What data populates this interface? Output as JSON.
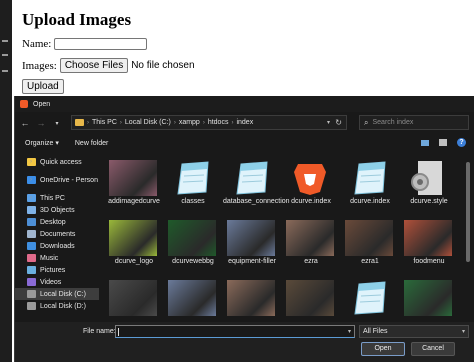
{
  "webpage": {
    "heading": "Upload Images",
    "name_label": "Name:",
    "name_value": "",
    "images_label": "Images:",
    "choose_files": "Choose Files",
    "no_file": "No file chosen",
    "upload": "Upload"
  },
  "dialog": {
    "title": "Open",
    "breadcrumbs": [
      "This PC",
      "Local Disk (C:)",
      "xampp",
      "htdocs",
      "index"
    ],
    "search_placeholder": "Search index",
    "toolbar": {
      "organize": "Organize ▾",
      "new_folder": "New folder"
    },
    "sidebar": [
      {
        "label": "Quick access",
        "icon": "star-icon",
        "color": "#f2c744"
      },
      {
        "label": "OneDrive - Person",
        "icon": "cloud-icon",
        "color": "#3b8ee8"
      },
      {
        "label": "This PC",
        "icon": "computer-icon",
        "color": "#5aa0e6"
      },
      {
        "label": "3D Objects",
        "icon": "cube-icon",
        "color": "#7fb3e8"
      },
      {
        "label": "Desktop",
        "icon": "desktop-icon",
        "color": "#4d8fd6"
      },
      {
        "label": "Documents",
        "icon": "document-icon",
        "color": "#9fb5cf"
      },
      {
        "label": "Downloads",
        "icon": "download-icon",
        "color": "#3f8fe0"
      },
      {
        "label": "Music",
        "icon": "music-icon",
        "color": "#e06a8a"
      },
      {
        "label": "Pictures",
        "icon": "pictures-icon",
        "color": "#6ab0e0"
      },
      {
        "label": "Videos",
        "icon": "video-icon",
        "color": "#8a6ad6"
      },
      {
        "label": "Local Disk (C:)",
        "icon": "disk-icon",
        "color": "#9a9a9a"
      },
      {
        "label": "Local Disk (D:)",
        "icon": "disk-icon",
        "color": "#9a9a9a"
      }
    ],
    "files": [
      {
        "name": "addimagedcurve",
        "kind": "photo",
        "color": "#8a5a6a"
      },
      {
        "name": "classes",
        "kind": "text-doc",
        "color": "#8ed0e8"
      },
      {
        "name": "database_connection",
        "kind": "text-doc",
        "color": "#8ed0e8"
      },
      {
        "name": "dcurve.index",
        "kind": "brave-browser",
        "color": "#f05a28"
      },
      {
        "name": "dcurve.index",
        "kind": "text-doc",
        "color": "#8ed0e8"
      },
      {
        "name": "dcurve.style",
        "kind": "settings-doc",
        "color": "#d8d8d8"
      },
      {
        "name": "dcurve_logo",
        "kind": "photo",
        "color": "#9ab83a"
      },
      {
        "name": "dcurvewebbg",
        "kind": "photo",
        "color": "#1f5a2a"
      },
      {
        "name": "equipment-filler",
        "kind": "photo",
        "color": "#6a7a9a"
      },
      {
        "name": "ezra",
        "kind": "photo",
        "color": "#8a6a5a"
      },
      {
        "name": "ezra1",
        "kind": "photo",
        "color": "#6a4a3a"
      },
      {
        "name": "foodmenu",
        "kind": "photo",
        "color": "#b0503a"
      },
      {
        "name": "",
        "kind": "photo",
        "color": "#4a4a4a"
      },
      {
        "name": "",
        "kind": "photo",
        "color": "#6a7a9a"
      },
      {
        "name": "",
        "kind": "photo",
        "color": "#8a6a5a"
      },
      {
        "name": "",
        "kind": "photo",
        "color": "#5a4a3a"
      },
      {
        "name": "",
        "kind": "jpg-doc",
        "color": "#8ed0e8"
      },
      {
        "name": "",
        "kind": "photo",
        "color": "#2a6a3a"
      }
    ],
    "file_name_label": "File name:",
    "file_name_value": "",
    "file_type": "All Files",
    "open_button": "Open",
    "cancel_button": "Cancel"
  }
}
